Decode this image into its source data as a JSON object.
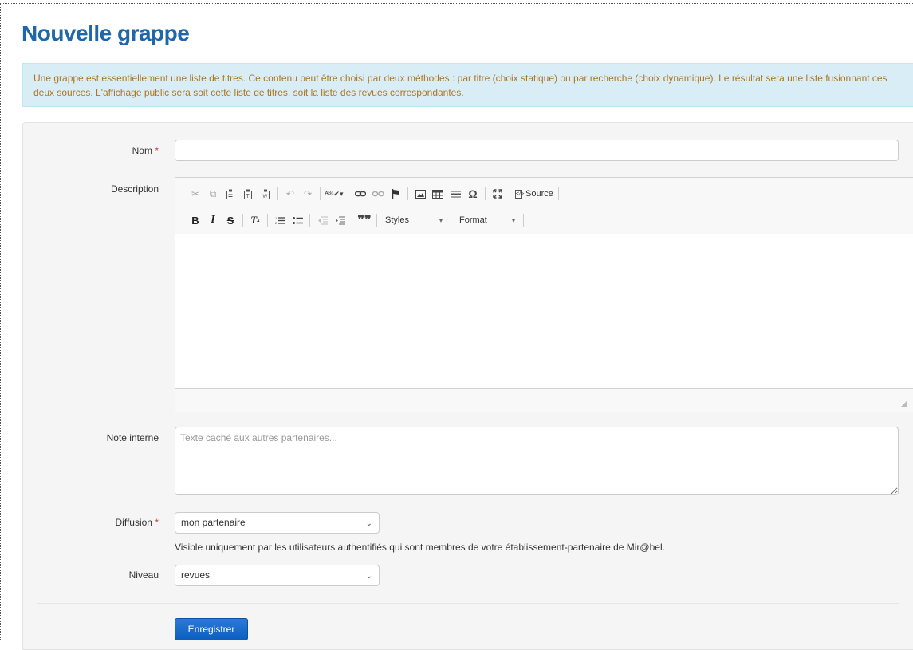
{
  "page": {
    "title": "Nouvelle grappe",
    "info": "Une grappe est essentiellement une liste de titres. Ce contenu peut être choisi par deux méthodes : par titre (choix statique) ou par recherche (choix dynamique). Le résultat sera une liste fusionnant ces deux sources. L'affichage public sera soit cette liste de titres, soit la liste des revues correspondantes."
  },
  "form": {
    "nom_label": "Nom",
    "required_mark": "*",
    "nom_value": "",
    "description_label": "Description",
    "note_label": "Note interne",
    "note_placeholder": "Texte caché aux autres partenaires...",
    "diffusion_label": "Diffusion",
    "diffusion_value": "mon partenaire",
    "diffusion_help": "Visible uniquement par les utilisateurs authentifiés qui sont membres de votre établissement-partenaire de Mir@bel.",
    "niveau_label": "Niveau",
    "niveau_value": "revues",
    "submit_label": "Enregistrer"
  },
  "editor": {
    "source_label": "Source",
    "styles_label": "Styles",
    "format_label": "Format",
    "icons_row1": [
      "cut-icon",
      "copy-icon",
      "paste-icon",
      "paste-text-icon",
      "paste-word-icon",
      "undo-icon",
      "redo-icon",
      "spellcheck-icon",
      "link-icon",
      "unlink-icon",
      "anchor-icon",
      "image-icon",
      "table-icon",
      "horizontal-rule-icon",
      "special-char-icon",
      "maximize-icon",
      "source-icon"
    ],
    "icons_row2": [
      "bold-icon",
      "italic-icon",
      "strike-icon",
      "remove-format-icon",
      "numbered-list-icon",
      "bulleted-list-icon",
      "outdent-icon",
      "indent-icon",
      "blockquote-icon"
    ]
  },
  "colors": {
    "title": "#1f67a9",
    "info_bg": "#d9edf7",
    "info_text": "#b0751e",
    "primary_button": "#1566c8",
    "required": "#b94a48"
  }
}
